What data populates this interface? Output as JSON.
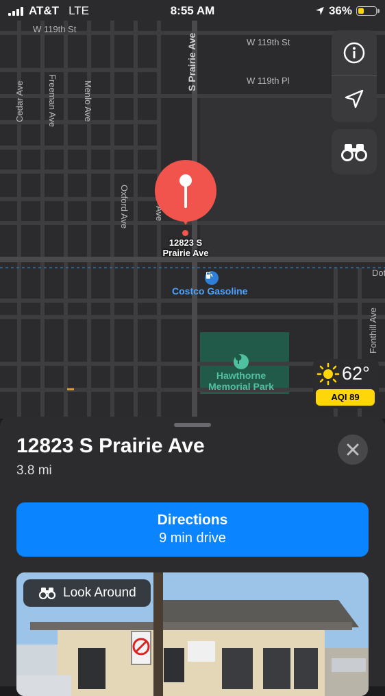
{
  "status_bar": {
    "carrier": "AT&T",
    "network": "LTE",
    "time": "8:55 AM",
    "battery": "36%",
    "battery_level": 0.36,
    "battery_color": "#ffd60a"
  },
  "map": {
    "streets": {
      "w119th_st_left": "W 119th St",
      "w119th_st_right": "W 119th St",
      "w119th_pl": "W 119th Pl",
      "prairie": "S Prairie Ave",
      "cedar": "Cedar Ave",
      "freeman": "Freeman Ave",
      "menlo": "Menlo Ave",
      "oxford": "Oxford Ave",
      "ave_fragment": "Ave",
      "dot_fragment": "Dot",
      "fonthill": "Fonthill Ave"
    },
    "pin_label_line1": "12823 S",
    "pin_label_line2": "Prairie Ave",
    "poi_label": "Costco Gasoline",
    "park_label_line1": "Hawthorne",
    "park_label_line2": "Memorial Park",
    "accent_pin": "#f0544c",
    "accent_poi": "#4aa3ff",
    "accent_park": "#4fc1a0"
  },
  "map_controls": {
    "info_icon": "info-icon",
    "location_icon": "location-arrow-icon",
    "look_around_icon": "binoculars-icon"
  },
  "weather": {
    "temperature": "62°",
    "aqi": "AQI 89",
    "aqi_color": "#ffd60a"
  },
  "place_card": {
    "title": "12823 S Prairie Ave",
    "distance": "3.8 mi",
    "directions_label": "Directions",
    "directions_sub": "9 min drive",
    "look_around_label": "Look Around",
    "directions_color": "#0a84ff"
  }
}
